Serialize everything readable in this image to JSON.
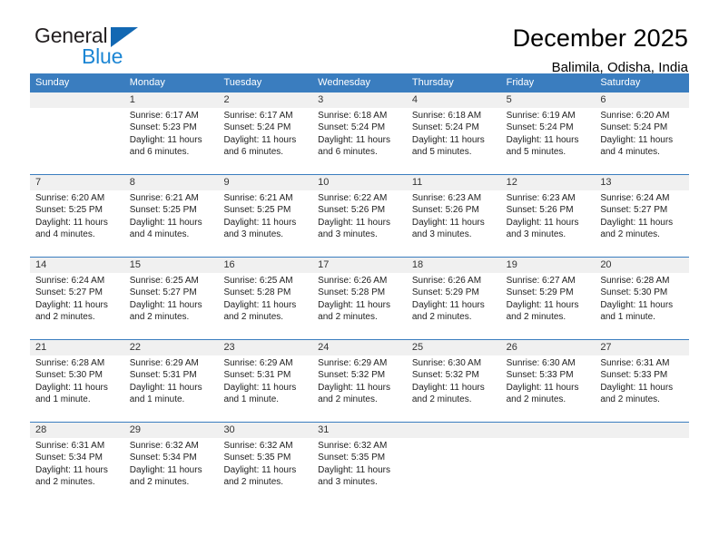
{
  "logo": {
    "primary_text": "General",
    "secondary_text": "Blue",
    "primary_color": "#231f20",
    "secondary_color": "#1c86d4",
    "triangle_color": "#1268b3",
    "icon": "triangle-icon"
  },
  "header": {
    "title": "December 2025",
    "subtitle": "Balimila, Odisha, India"
  },
  "theme": {
    "header_bg": "#3a7dbf",
    "header_text": "#ffffff",
    "daynum_bg": "#f0f0f0",
    "cell_bg": "#ffffff",
    "rule_color": "#3a7dbf"
  },
  "weekdays": [
    "Sunday",
    "Monday",
    "Tuesday",
    "Wednesday",
    "Thursday",
    "Friday",
    "Saturday"
  ],
  "weeks": [
    {
      "days": [
        {
          "num": "",
          "sunrise": "",
          "sunset": "",
          "daylight": ""
        },
        {
          "num": "1",
          "sunrise": "Sunrise: 6:17 AM",
          "sunset": "Sunset: 5:23 PM",
          "daylight": "Daylight: 11 hours and 6 minutes."
        },
        {
          "num": "2",
          "sunrise": "Sunrise: 6:17 AM",
          "sunset": "Sunset: 5:24 PM",
          "daylight": "Daylight: 11 hours and 6 minutes."
        },
        {
          "num": "3",
          "sunrise": "Sunrise: 6:18 AM",
          "sunset": "Sunset: 5:24 PM",
          "daylight": "Daylight: 11 hours and 6 minutes."
        },
        {
          "num": "4",
          "sunrise": "Sunrise: 6:18 AM",
          "sunset": "Sunset: 5:24 PM",
          "daylight": "Daylight: 11 hours and 5 minutes."
        },
        {
          "num": "5",
          "sunrise": "Sunrise: 6:19 AM",
          "sunset": "Sunset: 5:24 PM",
          "daylight": "Daylight: 11 hours and 5 minutes."
        },
        {
          "num": "6",
          "sunrise": "Sunrise: 6:20 AM",
          "sunset": "Sunset: 5:24 PM",
          "daylight": "Daylight: 11 hours and 4 minutes."
        }
      ]
    },
    {
      "days": [
        {
          "num": "7",
          "sunrise": "Sunrise: 6:20 AM",
          "sunset": "Sunset: 5:25 PM",
          "daylight": "Daylight: 11 hours and 4 minutes."
        },
        {
          "num": "8",
          "sunrise": "Sunrise: 6:21 AM",
          "sunset": "Sunset: 5:25 PM",
          "daylight": "Daylight: 11 hours and 4 minutes."
        },
        {
          "num": "9",
          "sunrise": "Sunrise: 6:21 AM",
          "sunset": "Sunset: 5:25 PM",
          "daylight": "Daylight: 11 hours and 3 minutes."
        },
        {
          "num": "10",
          "sunrise": "Sunrise: 6:22 AM",
          "sunset": "Sunset: 5:26 PM",
          "daylight": "Daylight: 11 hours and 3 minutes."
        },
        {
          "num": "11",
          "sunrise": "Sunrise: 6:23 AM",
          "sunset": "Sunset: 5:26 PM",
          "daylight": "Daylight: 11 hours and 3 minutes."
        },
        {
          "num": "12",
          "sunrise": "Sunrise: 6:23 AM",
          "sunset": "Sunset: 5:26 PM",
          "daylight": "Daylight: 11 hours and 3 minutes."
        },
        {
          "num": "13",
          "sunrise": "Sunrise: 6:24 AM",
          "sunset": "Sunset: 5:27 PM",
          "daylight": "Daylight: 11 hours and 2 minutes."
        }
      ]
    },
    {
      "days": [
        {
          "num": "14",
          "sunrise": "Sunrise: 6:24 AM",
          "sunset": "Sunset: 5:27 PM",
          "daylight": "Daylight: 11 hours and 2 minutes."
        },
        {
          "num": "15",
          "sunrise": "Sunrise: 6:25 AM",
          "sunset": "Sunset: 5:27 PM",
          "daylight": "Daylight: 11 hours and 2 minutes."
        },
        {
          "num": "16",
          "sunrise": "Sunrise: 6:25 AM",
          "sunset": "Sunset: 5:28 PM",
          "daylight": "Daylight: 11 hours and 2 minutes."
        },
        {
          "num": "17",
          "sunrise": "Sunrise: 6:26 AM",
          "sunset": "Sunset: 5:28 PM",
          "daylight": "Daylight: 11 hours and 2 minutes."
        },
        {
          "num": "18",
          "sunrise": "Sunrise: 6:26 AM",
          "sunset": "Sunset: 5:29 PM",
          "daylight": "Daylight: 11 hours and 2 minutes."
        },
        {
          "num": "19",
          "sunrise": "Sunrise: 6:27 AM",
          "sunset": "Sunset: 5:29 PM",
          "daylight": "Daylight: 11 hours and 2 minutes."
        },
        {
          "num": "20",
          "sunrise": "Sunrise: 6:28 AM",
          "sunset": "Sunset: 5:30 PM",
          "daylight": "Daylight: 11 hours and 1 minute."
        }
      ]
    },
    {
      "days": [
        {
          "num": "21",
          "sunrise": "Sunrise: 6:28 AM",
          "sunset": "Sunset: 5:30 PM",
          "daylight": "Daylight: 11 hours and 1 minute."
        },
        {
          "num": "22",
          "sunrise": "Sunrise: 6:29 AM",
          "sunset": "Sunset: 5:31 PM",
          "daylight": "Daylight: 11 hours and 1 minute."
        },
        {
          "num": "23",
          "sunrise": "Sunrise: 6:29 AM",
          "sunset": "Sunset: 5:31 PM",
          "daylight": "Daylight: 11 hours and 1 minute."
        },
        {
          "num": "24",
          "sunrise": "Sunrise: 6:29 AM",
          "sunset": "Sunset: 5:32 PM",
          "daylight": "Daylight: 11 hours and 2 minutes."
        },
        {
          "num": "25",
          "sunrise": "Sunrise: 6:30 AM",
          "sunset": "Sunset: 5:32 PM",
          "daylight": "Daylight: 11 hours and 2 minutes."
        },
        {
          "num": "26",
          "sunrise": "Sunrise: 6:30 AM",
          "sunset": "Sunset: 5:33 PM",
          "daylight": "Daylight: 11 hours and 2 minutes."
        },
        {
          "num": "27",
          "sunrise": "Sunrise: 6:31 AM",
          "sunset": "Sunset: 5:33 PM",
          "daylight": "Daylight: 11 hours and 2 minutes."
        }
      ]
    },
    {
      "days": [
        {
          "num": "28",
          "sunrise": "Sunrise: 6:31 AM",
          "sunset": "Sunset: 5:34 PM",
          "daylight": "Daylight: 11 hours and 2 minutes."
        },
        {
          "num": "29",
          "sunrise": "Sunrise: 6:32 AM",
          "sunset": "Sunset: 5:34 PM",
          "daylight": "Daylight: 11 hours and 2 minutes."
        },
        {
          "num": "30",
          "sunrise": "Sunrise: 6:32 AM",
          "sunset": "Sunset: 5:35 PM",
          "daylight": "Daylight: 11 hours and 2 minutes."
        },
        {
          "num": "31",
          "sunrise": "Sunrise: 6:32 AM",
          "sunset": "Sunset: 5:35 PM",
          "daylight": "Daylight: 11 hours and 3 minutes."
        },
        {
          "num": "",
          "sunrise": "",
          "sunset": "",
          "daylight": ""
        },
        {
          "num": "",
          "sunrise": "",
          "sunset": "",
          "daylight": ""
        },
        {
          "num": "",
          "sunrise": "",
          "sunset": "",
          "daylight": ""
        }
      ]
    }
  ]
}
